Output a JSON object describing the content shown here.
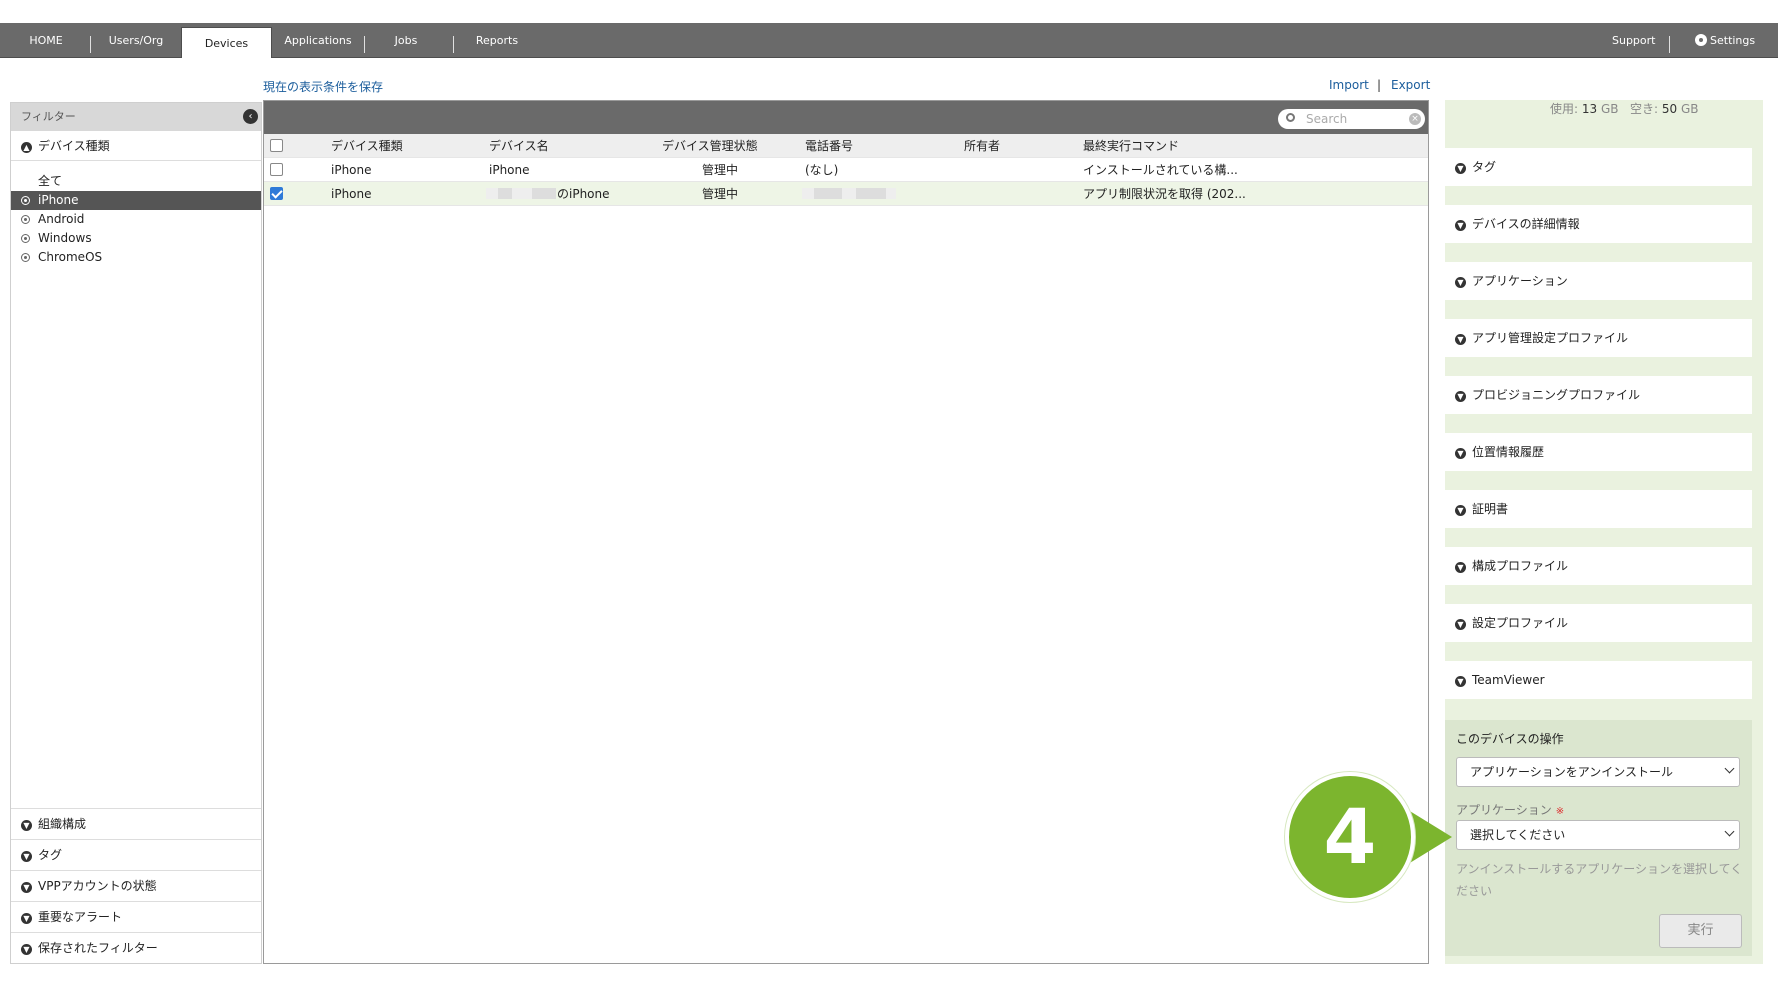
{
  "nav": {
    "tabs": [
      "HOME",
      "Users/Org",
      "Devices",
      "Applications",
      "Jobs",
      "Reports"
    ],
    "support": "Support",
    "settings": "Settings"
  },
  "links": {
    "save_view": "現在の表示条件を保存",
    "import": "Import",
    "divider": "|",
    "export": "Export"
  },
  "sidebar": {
    "header": "フィルター",
    "device_type_section": "デバイス種類",
    "device_types": [
      "全て",
      "iPhone",
      "Android",
      "Windows",
      "ChromeOS"
    ],
    "bottom_sections": [
      "組織構成",
      "タグ",
      "VPPアカウントの状態",
      "重要なアラート",
      "保存されたフィルター"
    ]
  },
  "table": {
    "search_placeholder": "Search",
    "columns": [
      "デバイス種類",
      "デバイス名",
      "デバイス管理状態",
      "電話番号",
      "所有者",
      "最終実行コマンド"
    ],
    "rows": [
      {
        "type": "iPhone",
        "name": "iPhone",
        "status": "管理中",
        "phone": "(なし)",
        "owner": "",
        "last_command": "インストールされている構...",
        "checked": false
      },
      {
        "type": "iPhone",
        "name": "のiPhone",
        "status": "管理中",
        "phone": "",
        "owner": "",
        "last_command": "アプリ制限状況を取得 (202...",
        "checked": true
      }
    ]
  },
  "right_panel": {
    "storage_used_label": "使用:",
    "storage_used": "13",
    "storage_free_label": "空き:",
    "storage_free": "50",
    "storage_unit": "GB",
    "sections": [
      "タグ",
      "デバイスの詳細情報",
      "アプリケーション",
      "アプリ管理設定プロファイル",
      "プロビジョニングプロファイル",
      "位置情報履歴",
      "証明書",
      "構成プロファイル",
      "設定プロファイル",
      "TeamViewer"
    ],
    "operation": {
      "title": "このデバイスの操作",
      "action_selected": "アプリケーションをアンインストール",
      "app_label": "アプリケーション",
      "required_mark": "※",
      "app_selected": "選択してください",
      "help": "アンインストールするアプリケーションを選択してください",
      "run_button": "実行"
    }
  },
  "callout": {
    "number": "4",
    "color": "#7cb52e"
  }
}
